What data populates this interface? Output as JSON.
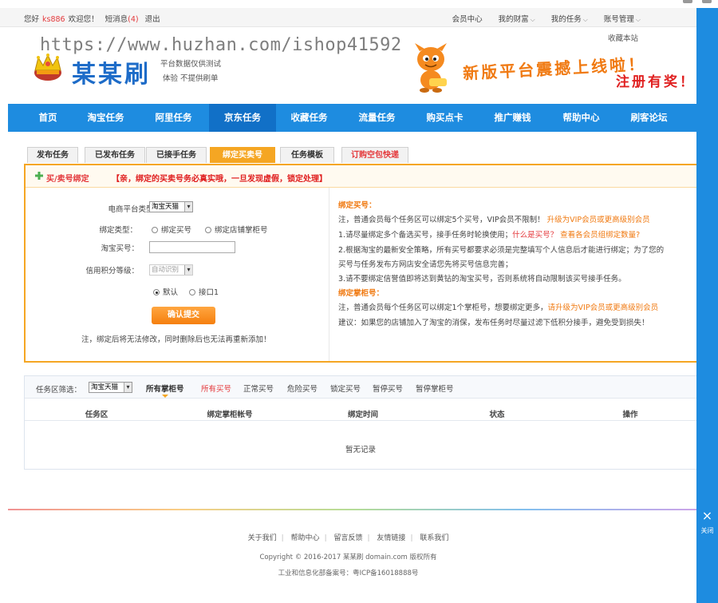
{
  "topbar": {
    "greeting": "您好",
    "username": "ks886",
    "welcome": "欢迎您！",
    "messages_label": "短消息",
    "messages_count": "(4)",
    "logout": "退出",
    "right_links": [
      "会员中心",
      "我的财富",
      "我的任务",
      "账号管理"
    ]
  },
  "header": {
    "watermark": "https://www.huzhan.com/ishop41592",
    "favorite": "收藏本站",
    "logo_text": "某某刷",
    "logo_sub1": "平台数据仅供测试",
    "logo_sub2": "体验  不提供刷单",
    "banner1": "新版平台震撼上线啦！",
    "banner2": "注册有奖！"
  },
  "nav": {
    "items": [
      "首页",
      "淘宝任务",
      "阿里任务",
      "京东任务",
      "收藏任务",
      "流量任务",
      "购买点卡",
      "推广赚钱",
      "帮助中心",
      "刷客论坛"
    ],
    "active": "京东任务"
  },
  "subtabs": [
    "发布任务",
    "已发布任务",
    "已接手任务",
    "绑定买卖号",
    "任务模板",
    "订购空包快递"
  ],
  "panel": {
    "title": "买/卖号绑定",
    "warning": "【亲，绑定的买卖号务必真实哦，一旦发现虚假，锁定处理】",
    "form": {
      "platform_label": "电商平台类型：",
      "platform_value": "淘宝天猫",
      "bind_type_label": "绑定类型：",
      "bind_options": [
        "绑定买号",
        "绑定店铺掌柜号"
      ],
      "buyer_label": "淘宝买号：",
      "buyer_value": "",
      "credit_label": "信用积分等级：",
      "credit_value": "自动识别",
      "interface_options": [
        "默认",
        "接口1"
      ],
      "submit": "确认提交",
      "note": "注，绑定后将无法修改，同时删除后也无法再重新添加！"
    },
    "info": {
      "buyer_title": "绑定买号：",
      "buyer_line1_a": "注，普通会员每个任务区可以绑定5个买号，VIP会员不限制！",
      "buyer_line1_b": "升级为VIP会员或更高级别会员",
      "buyer_line2_a": "1.请尽量绑定多个备选买号，接手任务时轮换使用；",
      "buyer_line2_b": "什么是买号？",
      "buyer_line2_c": "查看各会员组绑定数量?",
      "buyer_line3": "2.根据淘宝的最新安全策略，所有买号都要求必须是完整填写个人信息后才能进行绑定；为了您的",
      "buyer_line4": "买号与任务发布方网店安全请您先将买号信息完善；",
      "buyer_line5": "3.请不要绑定信誉值即将达到黄钻的淘宝买号，否则系统将自动限制该买号接手任务。",
      "seller_title": "绑定掌柜号：",
      "seller_line1_a": "注，普通会员每个任务区可以绑定1个掌柜号，想要绑定更多，",
      "seller_line1_b": "请升级为VIP会员或更高级别会员",
      "seller_line2": "建议：如果您的店铺加入了淘宝的消保，发布任务时尽量过滤下低积分接手，避免受到损失！"
    }
  },
  "records": {
    "filter_label": "任务区筛选：",
    "filter_value": "淘宝天猫",
    "tabs": [
      "所有掌柜号",
      "所有买号",
      "正常买号",
      "危险买号",
      "锁定买号",
      "暂停买号",
      "暂停掌柜号"
    ],
    "columns": [
      "任务区",
      "绑定掌柜帐号",
      "绑定时间",
      "状态",
      "操作"
    ],
    "empty": "暂无记录"
  },
  "footer": {
    "links": [
      "关于我们",
      "帮助中心",
      "留言反馈",
      "友情链接",
      "联系我们"
    ],
    "copyright": "Copyright © 2016-2017 某某刷  domain.com 版权所有",
    "icp": "工业和信息化部备案号：粤ICP备16018888号"
  },
  "sidebar": {
    "close_icon": "×",
    "close_label": "关闭"
  },
  "colors": {
    "nav_blue": "#1e8ce0",
    "nav_active": "#1170c7",
    "accent_orange": "#f5a623",
    "alert_red": "#e4393c"
  }
}
